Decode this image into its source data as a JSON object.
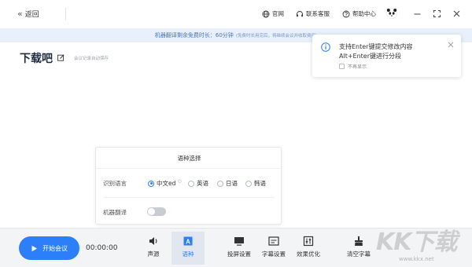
{
  "topbar": {
    "back_label": "返回",
    "links": {
      "website": "官网",
      "support": "联系客服",
      "help": "帮助中心"
    }
  },
  "notice": {
    "main": "机器翻译剩余免费时长：60分钟",
    "sub": "(免费时长用完后，将继续会议并收取费用)"
  },
  "document": {
    "title": "下载吧",
    "autosave": "会议记录自动保存"
  },
  "toast": {
    "line1": "支持Enter键提交修改内容",
    "line2": "Alt+Enter键进行分段",
    "dont_show": "不再显示"
  },
  "language_panel": {
    "title": "语种选择",
    "recognize_label": "识别语言",
    "options": [
      "中文ed",
      "英语",
      "日语",
      "韩语"
    ],
    "selected": "中文ed",
    "machine_translate_label": "机器翻译",
    "machine_translate_on": false
  },
  "bottom": {
    "start_label": "开始会议",
    "timer": "00:00:00",
    "tools": {
      "audio": "声源",
      "language": "语种",
      "projection": "投屏设置",
      "subtitle": "字幕设置",
      "optimize": "效果优化",
      "clear": "清空字幕"
    }
  },
  "watermark": {
    "text": "KK下载",
    "url": "www.kkx.net"
  },
  "colors": {
    "accent": "#2d7ff9",
    "notice_bg": "#e8f0fb"
  }
}
